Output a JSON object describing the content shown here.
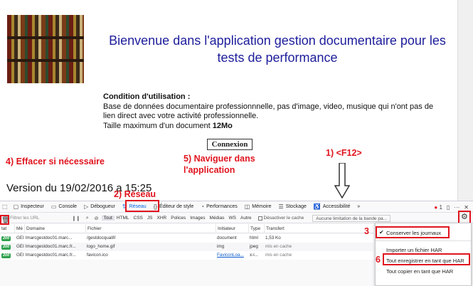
{
  "page": {
    "title": "Bienvenue dans l'application gestion documentaire pour les tests de performance",
    "condition_heading": "Condition d'utilisation :",
    "condition_lines": [
      "Base de données documentaire professionnnelle, pas d'image, video, musique qui n'ont pas de",
      "lien direct avec votre activité professionnelle.",
      "Taille maximum d'un document "
    ],
    "max_size": "12Mo",
    "connect_label": "Connexion",
    "version": "Version du 19/02/2016 a 15:25"
  },
  "annotations": {
    "a1": "1) <F12>",
    "a2": "2) Réseau",
    "a3": "3",
    "a4": "4) Effacer si nécessaire",
    "a5": "5) Naviguer dans l'application",
    "a6": "6"
  },
  "devtools": {
    "tabs": [
      {
        "label": "Inspecteur",
        "icon": "inspector-icon"
      },
      {
        "label": "Console",
        "icon": "console-icon"
      },
      {
        "label": "Débogueur",
        "icon": "debugger-icon"
      },
      {
        "label": "Réseau",
        "icon": "network-icon"
      },
      {
        "label": "Éditeur de style",
        "icon": "style-editor-icon"
      },
      {
        "label": "Performances",
        "icon": "performance-icon"
      },
      {
        "label": "Mémoire",
        "icon": "memory-icon"
      },
      {
        "label": "Stockage",
        "icon": "storage-icon"
      },
      {
        "label": "Accessibilité",
        "icon": "accessibility-icon"
      }
    ],
    "error_count": "1",
    "filter_placeholder": "Filtrer les URL",
    "filter_types": [
      "Tout",
      "HTML",
      "CSS",
      "JS",
      "XHR",
      "Polices",
      "Images",
      "Médias",
      "WS",
      "Autre"
    ],
    "disable_cache_label": "Désactiver le cache",
    "throttle_label": "Aucune limitation de la bande pa...",
    "columns": [
      "tat",
      "Mé",
      "Domaine",
      "Fichier",
      "Initiateur",
      "Type",
      "Transfert"
    ],
    "rows": [
      {
        "status": "200",
        "method": "GEI",
        "domain": "lmarcgestdoc01.marc...",
        "file": "/gestdocqualif/",
        "initiator": "document",
        "type": "html",
        "transfer": "1,53 Ko"
      },
      {
        "status": "200",
        "method": "GEI",
        "domain": "lmarcgestdoc01.marc.fr...",
        "file": "logo_home.gif",
        "initiator": "img",
        "type": "jpeg",
        "transfer": "mis en cache"
      },
      {
        "status": "200",
        "method": "GEI",
        "domain": "lmarcgestdoc01.marc.fr...",
        "file": "favicon.ico",
        "initiator": "FaviconLoa...",
        "type": "x-i...",
        "transfer": "mis en cache"
      }
    ],
    "menu": {
      "persist_logs": "Conserver les journaux",
      "import_har": "Importer un fichier HAR",
      "save_all_har": "Tout enregistrer en tant que HAR",
      "copy_all_har": "Tout copier en tant que HAR"
    }
  },
  "colors": {
    "title": "#1d1d9b",
    "annotation": "#e0141e",
    "active_tab": "#0060df",
    "status_ok": "#30a14e"
  }
}
